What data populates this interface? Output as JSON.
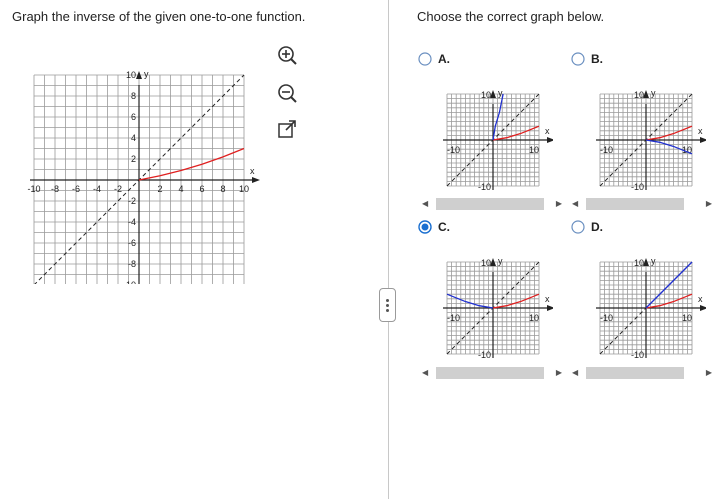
{
  "question": {
    "prompt": "Graph the inverse of the given one-to-one function.",
    "main_graph": {
      "x_tick_labels": [
        "-10",
        "-8",
        "-6",
        "-4",
        "-2",
        "2",
        "4",
        "6",
        "8",
        "10"
      ],
      "y_tick_labels": [
        "10",
        "8",
        "6",
        "4",
        "2",
        "-2",
        "-4",
        "-6",
        "-8",
        "-10"
      ],
      "x_axis_label": "x",
      "y_axis_label": "y",
      "curve_color": "#e02020",
      "function_curve": [
        [
          0,
          0
        ],
        [
          2,
          0.4
        ],
        [
          4,
          0.9
        ],
        [
          6,
          1.5
        ],
        [
          8,
          2.2
        ],
        [
          10,
          3
        ]
      ]
    },
    "tools": [
      {
        "name": "zoom-in-icon",
        "symbol": "+"
      },
      {
        "name": "zoom-out-icon",
        "symbol": "−"
      },
      {
        "name": "expand-icon",
        "symbol": "↗"
      }
    ]
  },
  "answers": {
    "prompt": "Choose the correct graph below.",
    "selected": "C",
    "options": [
      {
        "id": "A",
        "label": "A.",
        "tick_min": "-10",
        "tick_max": "10",
        "y_top": "10",
        "y_bottom": "-10",
        "x_axis_label": "x",
        "y_axis_label": "y",
        "red_curve": [
          [
            0,
            0
          ],
          [
            3,
            0.5
          ],
          [
            6,
            1.4
          ],
          [
            10,
            3
          ]
        ],
        "blue_curve": [
          [
            0,
            0
          ],
          [
            0.5,
            3
          ],
          [
            1.4,
            6
          ],
          [
            2.2,
            10
          ]
        ]
      },
      {
        "id": "B",
        "label": "B.",
        "tick_min": "-10",
        "tick_max": "10",
        "y_top": "10",
        "y_bottom": "-10",
        "x_axis_label": "x",
        "y_axis_label": "y",
        "red_curve": [
          [
            0,
            0
          ],
          [
            3,
            0.5
          ],
          [
            6,
            1.4
          ],
          [
            10,
            3
          ]
        ],
        "blue_curve": [
          [
            0,
            0
          ],
          [
            3,
            -0.5
          ],
          [
            6,
            -1.4
          ],
          [
            10,
            -3
          ]
        ]
      },
      {
        "id": "C",
        "label": "C.",
        "tick_min": "-10",
        "tick_max": "10",
        "y_top": "10",
        "y_bottom": "-10",
        "x_axis_label": "x",
        "y_axis_label": "y",
        "red_curve": [
          [
            0,
            0
          ],
          [
            3,
            0.5
          ],
          [
            6,
            1.4
          ],
          [
            10,
            3
          ]
        ],
        "blue_curve": [
          [
            -10,
            3
          ],
          [
            -6,
            1.4
          ],
          [
            -3,
            0.5
          ],
          [
            0,
            0
          ]
        ]
      },
      {
        "id": "D",
        "label": "D.",
        "tick_min": "-10",
        "tick_max": "10",
        "y_top": "10",
        "y_bottom": "-10",
        "x_axis_label": "x",
        "y_axis_label": "y",
        "red_curve": [
          [
            0,
            0
          ],
          [
            3,
            0.5
          ],
          [
            6,
            1.4
          ],
          [
            10,
            3
          ]
        ],
        "blue_curve": [
          [
            0,
            0
          ],
          [
            10,
            10
          ]
        ]
      }
    ]
  },
  "colors": {
    "grid": "#9a9a9a",
    "axes": "#222222",
    "red": "#e02020",
    "blue": "#2030d0",
    "radio_selected": "#1a6fd0"
  }
}
